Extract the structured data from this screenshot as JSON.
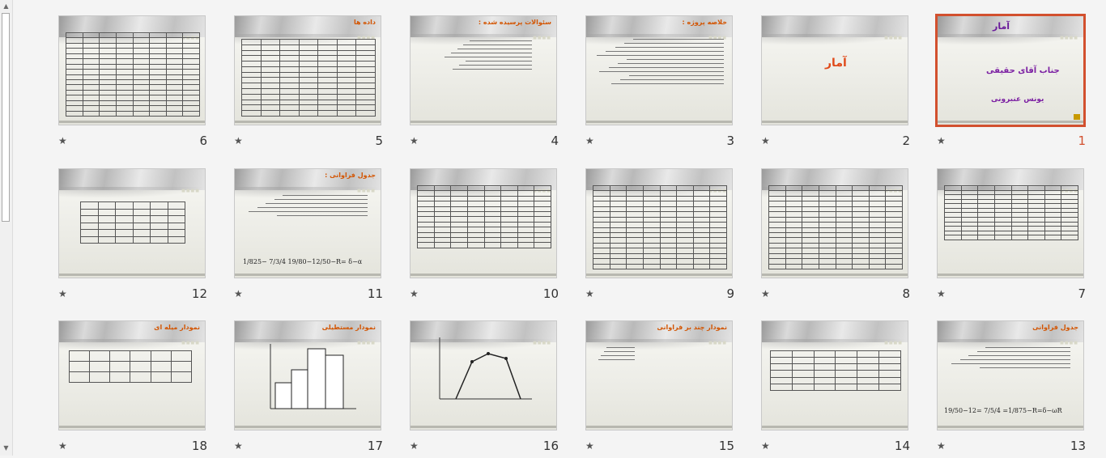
{
  "slides": [
    {
      "number": "1",
      "selected": true,
      "title": ""
    },
    {
      "number": "2",
      "title": "آمار"
    },
    {
      "number": "3",
      "title": "خلاصه پروژه :"
    },
    {
      "number": "4",
      "title": "سئوالات پرسیده شده :"
    },
    {
      "number": "5",
      "title": "داده ها"
    },
    {
      "number": "6",
      "title": ""
    },
    {
      "number": "7",
      "title": ""
    },
    {
      "number": "8",
      "title": ""
    },
    {
      "number": "9",
      "title": ""
    },
    {
      "number": "10",
      "title": ""
    },
    {
      "number": "11",
      "title": "جدول فراوانی :",
      "formula": "1/825− 7/3/4 19/80−12/50−R= δ−α"
    },
    {
      "number": "12",
      "title": ""
    },
    {
      "number": "13",
      "title": "جدول فراوانی",
      "formula": "19/50−12= 7/5/4 =1/875−R=δ−ωR"
    },
    {
      "number": "14",
      "title": ""
    },
    {
      "number": "15",
      "title": "نمودار چند بر فراوانی"
    },
    {
      "number": "16",
      "title": ""
    },
    {
      "number": "17",
      "title": "نمودار مستطیلی"
    },
    {
      "number": "18",
      "title": "نمودار میله ای"
    }
  ],
  "slide1": {
    "title": "آمار",
    "teacher": "جناب آقای حقیقی",
    "student": "یونس عنبرونی"
  },
  "star_glyph": "★",
  "colors": {
    "selected": "#d2502e",
    "title": "#d35400"
  }
}
